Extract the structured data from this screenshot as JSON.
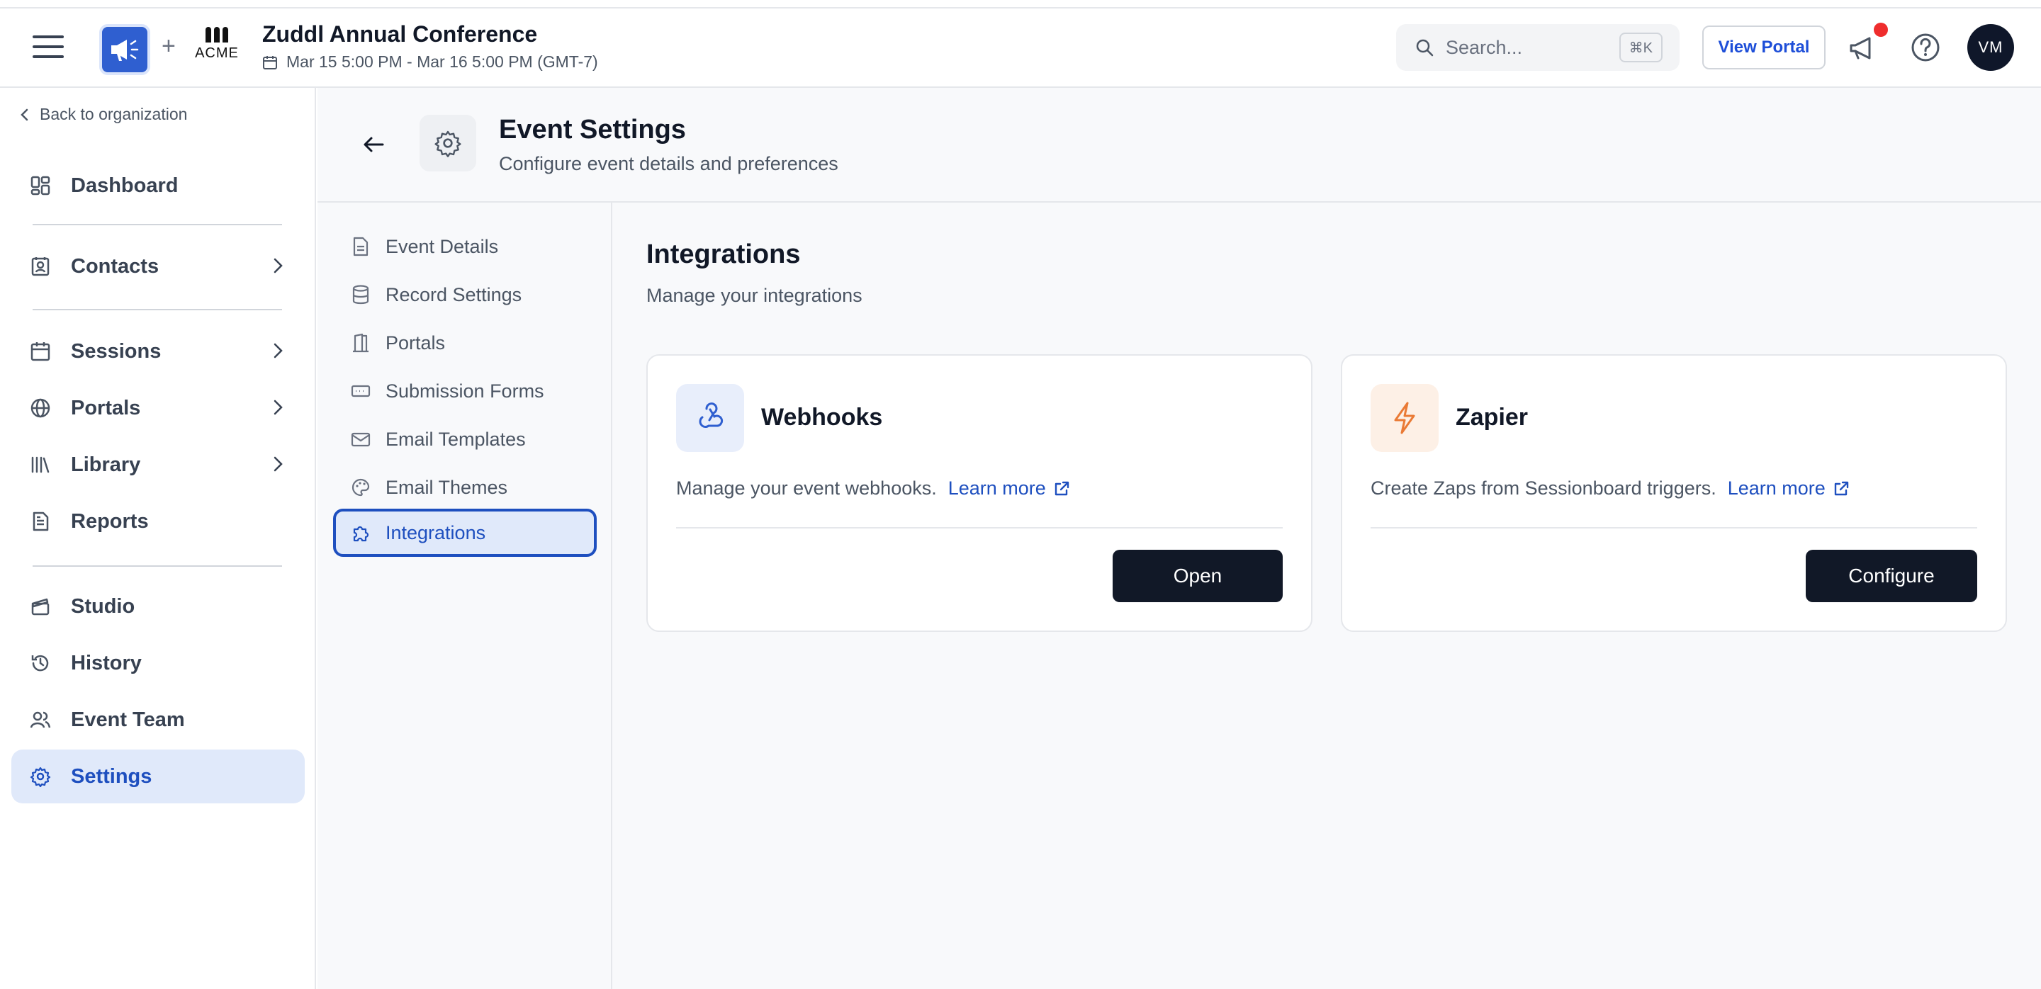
{
  "header": {
    "event_title": "Zuddl Annual Conference",
    "event_date": "Mar 15 5:00 PM - Mar 16 5:00 PM (GMT-7)",
    "plus": "+",
    "acme_logo_text": "ACME",
    "search_placeholder": "Search...",
    "search_shortcut": "⌘K",
    "view_portal": "View Portal",
    "avatar_initials": "VM"
  },
  "sidebar": {
    "back_label": "Back to organization",
    "items": [
      {
        "label": "Dashboard",
        "icon": "dashboard-icon"
      },
      {
        "label": "Contacts",
        "icon": "contacts-icon"
      },
      {
        "label": "Sessions",
        "icon": "calendar-icon"
      },
      {
        "label": "Portals",
        "icon": "globe-icon"
      },
      {
        "label": "Library",
        "icon": "library-icon"
      },
      {
        "label": "Reports",
        "icon": "report-icon"
      },
      {
        "label": "Studio",
        "icon": "clapperboard-icon"
      },
      {
        "label": "History",
        "icon": "history-icon"
      },
      {
        "label": "Event Team",
        "icon": "users-icon"
      },
      {
        "label": "Settings",
        "icon": "gear-icon"
      }
    ]
  },
  "page": {
    "title": "Event Settings",
    "subtitle": "Configure event details and preferences"
  },
  "subnav": {
    "items": [
      {
        "label": "Event Details"
      },
      {
        "label": "Record Settings"
      },
      {
        "label": "Portals"
      },
      {
        "label": "Submission Forms"
      },
      {
        "label": "Email Templates"
      },
      {
        "label": "Email Themes"
      },
      {
        "label": "Integrations"
      }
    ]
  },
  "content": {
    "title": "Integrations",
    "subtitle": "Manage your integrations",
    "cards": [
      {
        "name": "Webhooks",
        "description": "Manage your event webhooks.",
        "link": "Learn more",
        "button": "Open"
      },
      {
        "name": "Zapier",
        "description": "Create Zaps from Sessionboard triggers.",
        "link": "Learn more",
        "button": "Configure"
      }
    ]
  },
  "colors": {
    "accent": "#1e4fbf",
    "active_bg": "#e0e9fa",
    "dark_button": "#111827",
    "notification": "#ef2d2d",
    "zapier_orange": "#ea7a35"
  }
}
